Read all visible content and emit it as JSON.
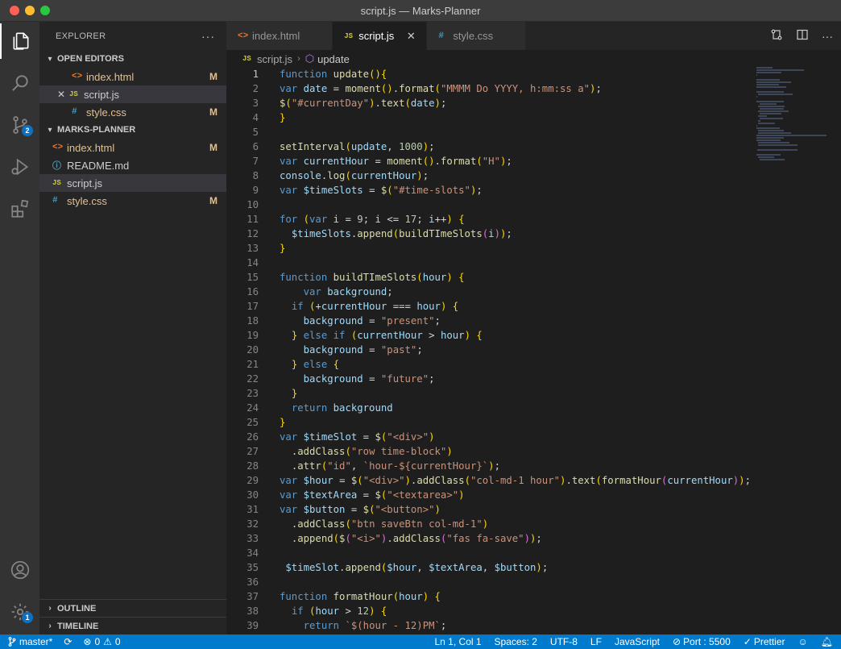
{
  "window": {
    "title": "script.js — Marks-Planner"
  },
  "explorer": {
    "title": "EXPLORER",
    "more": "···",
    "open_editors_title": "OPEN EDITORS",
    "open_editors": [
      {
        "icon": "html-file-icon",
        "label": "index.html",
        "status": "M"
      },
      {
        "icon": "js-file-icon",
        "label": "script.js",
        "status": ""
      },
      {
        "icon": "css-file-icon",
        "label": "style.css",
        "status": "M"
      }
    ],
    "project_title": "MARKS-PLANNER",
    "files": [
      {
        "icon": "html-file-icon",
        "label": "index.html",
        "status": "M"
      },
      {
        "icon": "info-file-icon",
        "label": "README.md",
        "status": ""
      },
      {
        "icon": "js-file-icon",
        "label": "script.js",
        "status": ""
      },
      {
        "icon": "css-file-icon",
        "label": "style.css",
        "status": "M"
      }
    ],
    "outline_title": "OUTLINE",
    "timeline_title": "TIMELINE"
  },
  "activity": {
    "scm_badge": "2",
    "accounts_badge": "1"
  },
  "tabs": [
    {
      "label": "index.html",
      "icon": "html-file-icon"
    },
    {
      "label": "script.js",
      "icon": "js-file-icon",
      "active": true
    },
    {
      "label": "style.css",
      "icon": "css-file-icon"
    }
  ],
  "icon_text": {
    "html": "<>",
    "js": "JS",
    "css": "#",
    "info": "ⓘ"
  },
  "breadcrumb": {
    "file": "script.js",
    "symbol": "update"
  },
  "code": {
    "active_line": 1,
    "lines": [
      "function update(){",
      "var date = moment().format(\"MMMM Do YYYY, h:mm:ss a\");",
      "$(\"#currentDay\").text(date);",
      "}",
      "",
      "setInterval(update, 1000);",
      "var currentHour = moment().format(\"H\");",
      "console.log(currentHour);",
      "var $timeSlots = $(\"#time-slots\");",
      "",
      "for (var i = 9; i <= 17; i++) {",
      "  $timeSlots.append(buildTImeSlots(i));",
      "}",
      "",
      "function buildTImeSlots(hour) {",
      "    var background;",
      "  if (+currentHour === hour) {",
      "    background = \"present\";",
      "  } else if (currentHour > hour) {",
      "    background = \"past\";",
      "  } else {",
      "    background = \"future\";",
      "  }",
      "  return background",
      "}",
      "var $timeSlot = $(\"<div>\")",
      "  .addClass(\"row time-block\")",
      "  .attr(\"id\", `hour-${currentHour}`);",
      "var $hour = $(\"<div>\").addClass(\"col-md-1 hour\").text(formatHour(currentHour));",
      "var $textArea = $(\"<textarea>\")",
      "var $button = $(\"<button>\")",
      "  .addClass(\"btn saveBtn col-md-1\")",
      "  .append($(\"<i>\").addClass(\"fas fa-save\"));",
      "",
      " $timeSlot.append($hour, $textArea, $button);",
      "",
      "function formatHour(hour) {",
      "  if (hour > 12) {",
      "    return `$(hour - 12)PM`;"
    ]
  },
  "statusbar": {
    "branch": "master*",
    "sync": "⟳",
    "errors": "0",
    "warnings": "0",
    "position": "Ln 1, Col 1",
    "spaces": "Spaces: 2",
    "encoding": "UTF-8",
    "eol": "LF",
    "language": "JavaScript",
    "port": "Port : 5500",
    "prettier": "Prettier"
  }
}
